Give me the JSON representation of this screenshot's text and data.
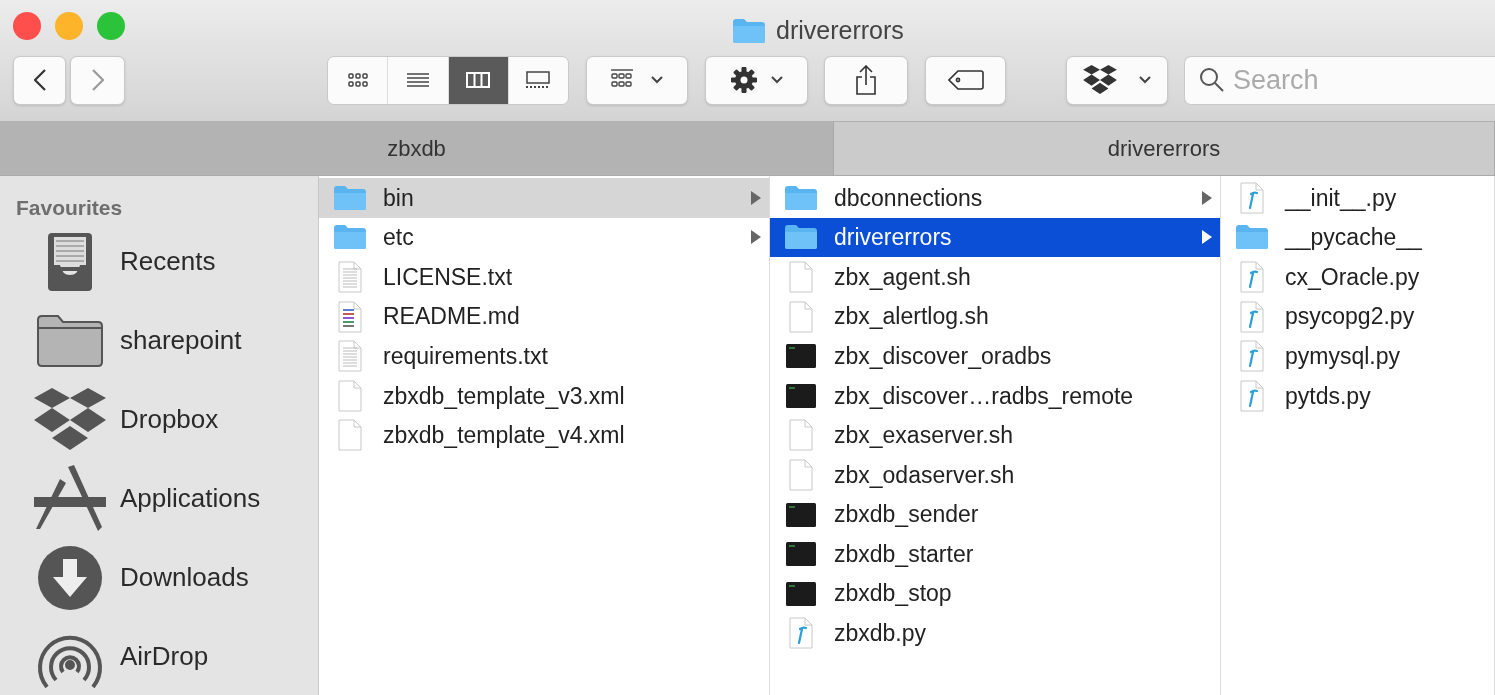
{
  "window": {
    "title": "drivererrors"
  },
  "toolbar": {
    "back": {
      "disabled": false
    },
    "forward": {
      "disabled": true
    },
    "view_modes": [
      {
        "kind": "icons",
        "selected": false
      },
      {
        "kind": "list",
        "selected": false
      },
      {
        "kind": "columns",
        "selected": true
      },
      {
        "kind": "gallery",
        "selected": false
      }
    ],
    "search": {
      "placeholder": "Search"
    }
  },
  "tabs": [
    {
      "label": "zbxdb",
      "selected": false
    },
    {
      "label": "drivererrors",
      "selected": true
    }
  ],
  "sidebar": {
    "heading": "Favourites",
    "items": [
      {
        "label": "Recents",
        "kind": "recents"
      },
      {
        "label": "sharepoint",
        "kind": "folder"
      },
      {
        "label": "Dropbox",
        "kind": "dropbox"
      },
      {
        "label": "Applications",
        "kind": "applications"
      },
      {
        "label": "Downloads",
        "kind": "downloads"
      },
      {
        "label": "AirDrop",
        "kind": "airdrop"
      }
    ]
  },
  "columns": [
    {
      "focused": false,
      "items": [
        {
          "name": "bin",
          "kind": "folder",
          "arrow": true,
          "selected": true
        },
        {
          "name": "etc",
          "kind": "folder",
          "arrow": true,
          "selected": false
        },
        {
          "name": "LICENSE.txt",
          "kind": "text",
          "arrow": false,
          "selected": false
        },
        {
          "name": "README.md",
          "kind": "markdown",
          "arrow": false,
          "selected": false
        },
        {
          "name": "requirements.txt",
          "kind": "text",
          "arrow": false,
          "selected": false
        },
        {
          "name": "zbxdb_template_v3.xml",
          "kind": "blank",
          "arrow": false,
          "selected": false
        },
        {
          "name": "zbxdb_template_v4.xml",
          "kind": "blank",
          "arrow": false,
          "selected": false
        }
      ]
    },
    {
      "focused": true,
      "items": [
        {
          "name": "dbconnections",
          "kind": "folder",
          "arrow": true,
          "selected": false
        },
        {
          "name": "drivererrors",
          "kind": "folder",
          "arrow": true,
          "selected": true
        },
        {
          "name": "zbx_agent.sh",
          "kind": "blank",
          "arrow": false,
          "selected": false
        },
        {
          "name": "zbx_alertlog.sh",
          "kind": "blank",
          "arrow": false,
          "selected": false
        },
        {
          "name": "zbx_discover_oradbs",
          "kind": "exec",
          "arrow": false,
          "selected": false
        },
        {
          "name": "zbx_discover…radbs_remote",
          "kind": "exec",
          "arrow": false,
          "selected": false
        },
        {
          "name": "zbx_exaserver.sh",
          "kind": "blank",
          "arrow": false,
          "selected": false
        },
        {
          "name": "zbx_odaserver.sh",
          "kind": "blank",
          "arrow": false,
          "selected": false
        },
        {
          "name": "zbxdb_sender",
          "kind": "exec",
          "arrow": false,
          "selected": false
        },
        {
          "name": "zbxdb_starter",
          "kind": "exec",
          "arrow": false,
          "selected": false
        },
        {
          "name": "zbxdb_stop",
          "kind": "exec",
          "arrow": false,
          "selected": false
        },
        {
          "name": "zbxdb.py",
          "kind": "python",
          "arrow": false,
          "selected": false
        }
      ]
    },
    {
      "items": [
        {
          "name": "__init__.py",
          "kind": "python",
          "arrow": false,
          "selected": false
        },
        {
          "name": "__pycache__",
          "kind": "folder",
          "arrow": false,
          "selected": false
        },
        {
          "name": "cx_Oracle.py",
          "kind": "python",
          "arrow": false,
          "selected": false
        },
        {
          "name": "psycopg2.py",
          "kind": "python",
          "arrow": false,
          "selected": false
        },
        {
          "name": "pymysql.py",
          "kind": "python",
          "arrow": false,
          "selected": false
        },
        {
          "name": "pytds.py",
          "kind": "python",
          "arrow": false,
          "selected": false
        }
      ]
    }
  ]
}
